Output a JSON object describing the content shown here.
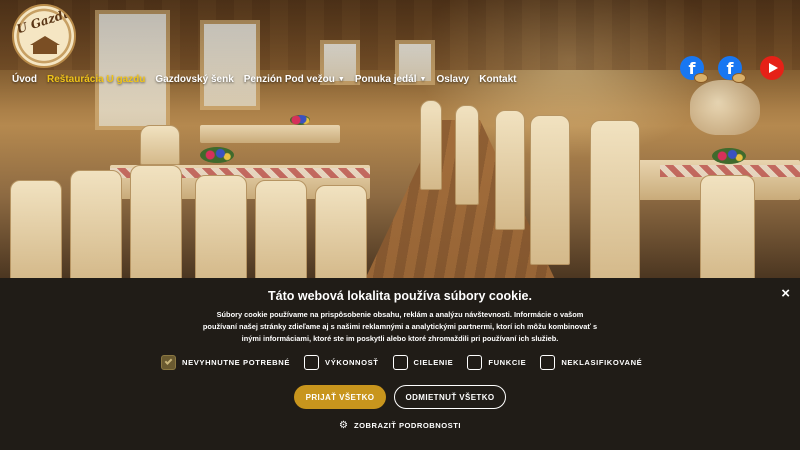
{
  "header": {
    "logo_text": "U Gazdu",
    "nav": [
      {
        "label": "Úvod",
        "active": false,
        "dropdown": false
      },
      {
        "label": "Reštaurácia U gazdu",
        "active": true,
        "dropdown": false
      },
      {
        "label": "Gazdovský šenk",
        "active": false,
        "dropdown": false
      },
      {
        "label": "Penzión Pod vežou",
        "active": false,
        "dropdown": true
      },
      {
        "label": "Ponuka jedál",
        "active": false,
        "dropdown": true
      },
      {
        "label": "Oslavy",
        "active": false,
        "dropdown": false
      },
      {
        "label": "Kontakt",
        "active": false,
        "dropdown": false
      }
    ],
    "social": {
      "facebook_1": "f",
      "facebook_2": "f",
      "youtube": "youtube-icon"
    }
  },
  "colors": {
    "accent": "#f0c419",
    "accept_button": "#c8951d",
    "banner_bg": "#201c17",
    "facebook": "#1877f2",
    "youtube": "#e62117"
  },
  "cookie": {
    "close": "×",
    "title": "Táto webová lokalita používa súbory cookie.",
    "text": "Súbory cookie používame na prispôsobenie obsahu, reklám a analýzu návštevnosti. Informácie o vašom používaní našej stránky zdieľame aj s našimi reklamnými a analytickými partnermi, ktorí ich môžu kombinovať s inými informáciami, ktoré ste im poskytli alebo ktoré zhromaždili pri používaní ich služieb.",
    "consents": [
      {
        "label": "NEVYHNUTNE POTREBNÉ",
        "checked": true
      },
      {
        "label": "VÝKONNOSŤ",
        "checked": false
      },
      {
        "label": "CIELENIE",
        "checked": false
      },
      {
        "label": "FUNKCIE",
        "checked": false
      },
      {
        "label": "NEKLASIFIKOVANÉ",
        "checked": false
      }
    ],
    "accept_label": "PRIJAŤ VŠETKO",
    "decline_label": "ODMIETNUŤ VŠETKO",
    "details_label": "ZOBRAZIŤ PODROBNOSTI",
    "details_icon": "gear-icon"
  }
}
